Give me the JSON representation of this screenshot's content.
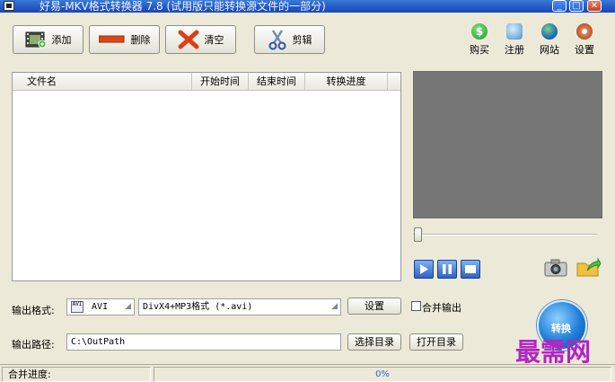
{
  "window": {
    "title": "好易-MKV格式转换器 7.8 (试用版只能转换源文件的一部分)",
    "minimize_glyph": "_",
    "maximize_glyph": "□",
    "close_glyph": "✕"
  },
  "toolbar": {
    "add_label": "添加",
    "delete_label": "删除",
    "clear_label": "清空",
    "cut_label": "剪辑",
    "buy_label": "购买",
    "register_label": "注册",
    "website_label": "网站",
    "settings_label": "设置"
  },
  "file_list": {
    "columns": [
      "文件名",
      "开始时间",
      "结束时间",
      "转换进度"
    ]
  },
  "player": {
    "slider_position": 0
  },
  "output": {
    "format_label": "输出格式:",
    "format_badge": "AVI",
    "format_value": "AVI",
    "codec_value": "DivX4+MP3格式 (*.avi)",
    "settings_button": "设置",
    "merge_label": "合并输出",
    "merge_checked": false,
    "path_label": "输出路径:",
    "path_value": "C:\\OutPath",
    "choose_dir_button": "选择目录",
    "open_dir_button": "打开目录"
  },
  "convert_label": "转换",
  "watermark": "最需网",
  "status": {
    "merge_progress_label": "合并进度:",
    "progress_value": "0%",
    "progress_fraction": 0
  },
  "colors": {
    "window_bg": "#ece9d8",
    "preview_bg": "#777777",
    "watermark": "#b225c2",
    "progress_text": "#3366cc"
  }
}
